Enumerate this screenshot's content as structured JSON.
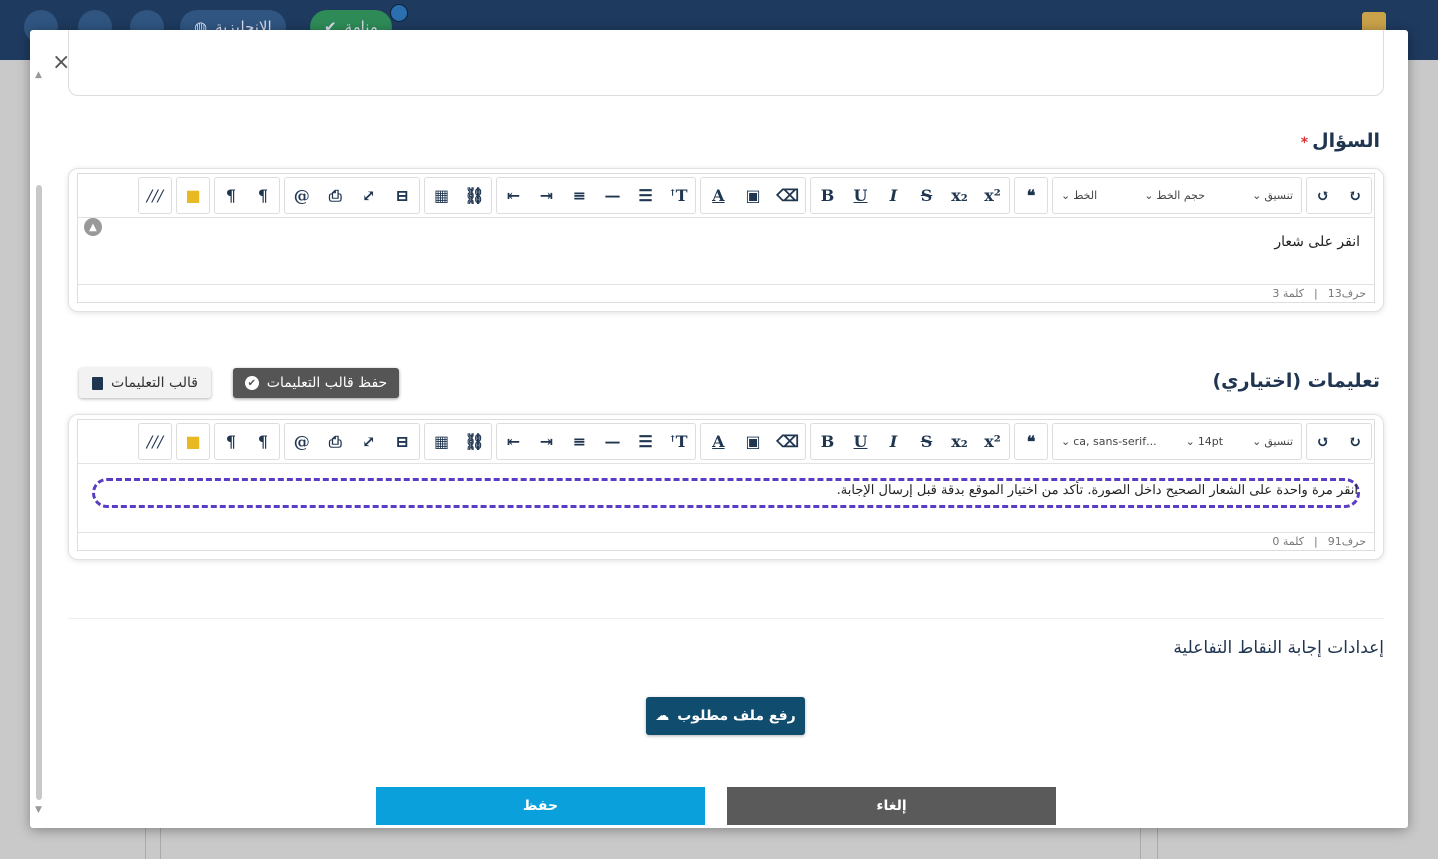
{
  "background": {
    "pill_1": "الإنجليزية",
    "pill_2": "منامة"
  },
  "modal": {
    "close": "×",
    "question": {
      "title": "السؤال",
      "required_mark": "*",
      "toolbar": {
        "format_select": "تنسيق",
        "size_select": "حجم الخط",
        "font_select": "الخط"
      },
      "content": "انقر على شعار",
      "status": {
        "chars": "حرف13",
        "separator": "|",
        "words": "كلمة 3"
      }
    },
    "instructions": {
      "title": "تعليمات (اختياري)",
      "save_template_label": "حفظ قالب التعليمات",
      "template_label": "قالب التعليمات",
      "toolbar": {
        "format_select": "تنسيق",
        "size_select": "14pt",
        "font_select": "...ca, sans-serif"
      },
      "content": "انقر مرة واحدة على الشعار الصحيح داخل الصورة. تأكد من اختيار الموقع بدقة قبل إرسال الإجابة.",
      "status": {
        "chars": "حرف91",
        "separator": "|",
        "words": "كلمة 0"
      }
    },
    "settings_title": "إعدادات إجابة النقاط التفاعلية",
    "upload_label": "رفع ملف مطلوب",
    "save_label": "حفظ",
    "cancel_label": "إلغاء"
  },
  "colors": {
    "primary_dark": "#1f3550",
    "save": "#0aa0dc",
    "cancel": "#5a5a5a",
    "upload": "#0f4c6e",
    "focus_outline": "#5b3cc4"
  }
}
